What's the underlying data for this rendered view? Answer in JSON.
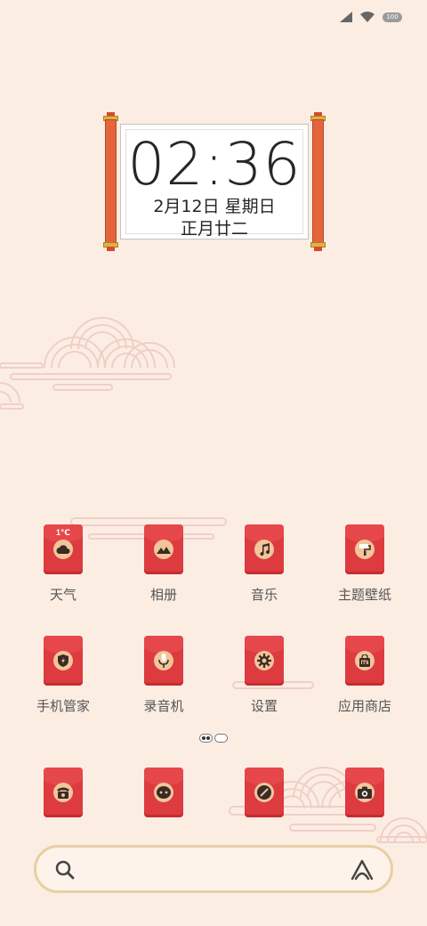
{
  "status_bar": {
    "battery": "100",
    "signal_icon": "cellular-signal-icon",
    "wifi_icon": "wifi-icon"
  },
  "clock_widget": {
    "time": "02:36",
    "date": "2月12日 星期日",
    "lunar": "正月廿二"
  },
  "apps": [
    {
      "label": "天气",
      "icon": "weather-cloud-icon",
      "badge": "1℃"
    },
    {
      "label": "相册",
      "icon": "gallery-mountain-icon"
    },
    {
      "label": "音乐",
      "icon": "music-note-icon"
    },
    {
      "label": "主题壁纸",
      "icon": "theme-brush-icon"
    },
    {
      "label": "手机管家",
      "icon": "security-shield-icon"
    },
    {
      "label": "录音机",
      "icon": "microphone-icon"
    },
    {
      "label": "设置",
      "icon": "gear-icon"
    },
    {
      "label": "应用商店",
      "icon": "mi-store-bag-icon"
    }
  ],
  "dock": [
    {
      "icon": "phone-icon"
    },
    {
      "icon": "messages-icon"
    },
    {
      "icon": "browser-compass-icon"
    },
    {
      "icon": "camera-icon"
    }
  ],
  "page_indicator": {
    "pages": 2,
    "current": 1
  },
  "search_bar": {
    "search_icon": "search-icon",
    "assistant_icon": "assistant-icon"
  },
  "colors": {
    "background": "#fcede3",
    "icon_red": "#dd3b3f",
    "medal": "#f2c59a",
    "scroll_rod": "#e5643c",
    "search_border": "#e8cfa3"
  }
}
